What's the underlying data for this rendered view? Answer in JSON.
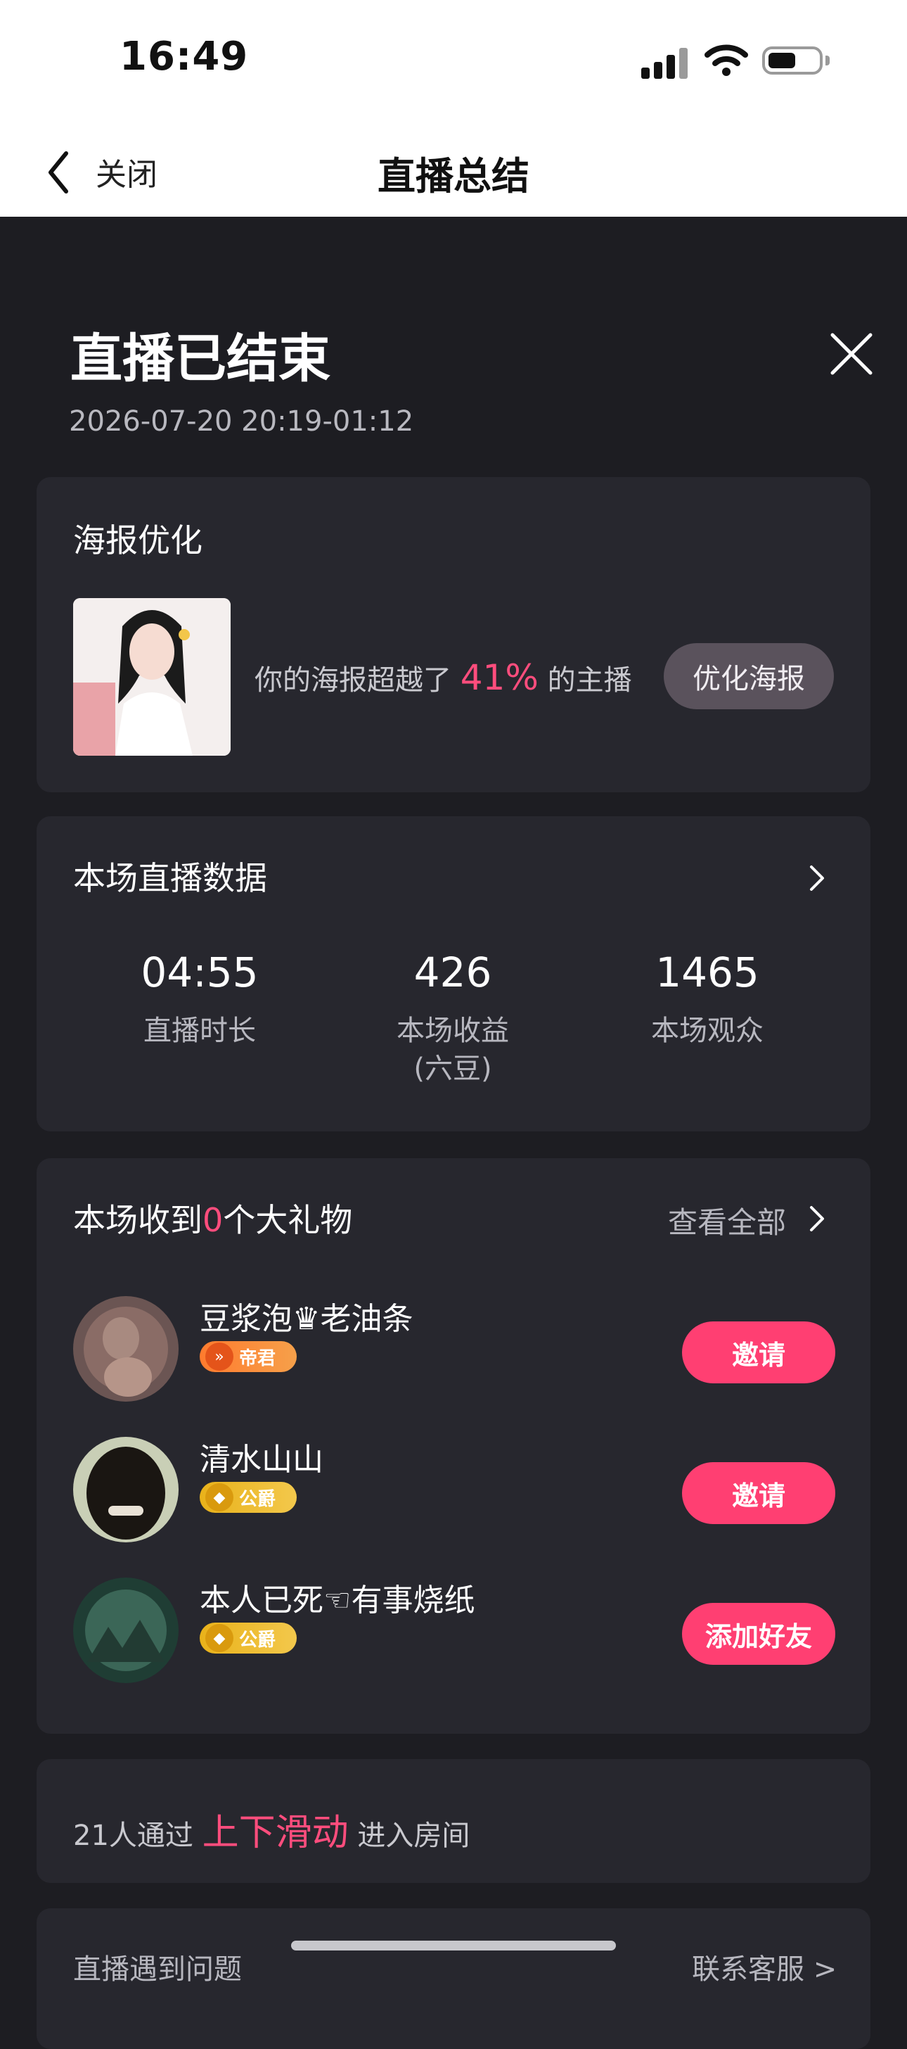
{
  "status_bar": {
    "time": "16:49"
  },
  "nav": {
    "back_label": "关闭",
    "title": "直播总结"
  },
  "header": {
    "title": "直播已结束",
    "time_range": "2026-07-20 20:19-01:12"
  },
  "poster": {
    "title": "海报优化",
    "text_before": "你的海报超越了",
    "percent": "41%",
    "text_after": "的主播",
    "button": "优化海报"
  },
  "stats": {
    "title": "本场直播数据",
    "items": [
      {
        "value": "04:55",
        "label": "直播时长"
      },
      {
        "value": "426",
        "label": "本场收益\n(六豆)"
      },
      {
        "value": "1465",
        "label": "本场观众"
      }
    ]
  },
  "gifts": {
    "prefix": "本场收到",
    "count": "0",
    "suffix": "个大礼物",
    "view_all": "查看全部",
    "users": [
      {
        "name": "豆浆泡♛老油条",
        "badge": "帝君",
        "action": "邀请"
      },
      {
        "name": "清水山山",
        "badge": "公爵",
        "action": "邀请"
      },
      {
        "name": "本人已死☜有事烧纸",
        "badge": "公爵",
        "action": "添加好友"
      }
    ]
  },
  "swipe": {
    "before": "21人通过",
    "highlight": "上下滑动",
    "after": "进入房间"
  },
  "help": {
    "question": "直播遇到问题",
    "contact": "联系客服 >"
  },
  "colors": {
    "accent": "#ff3f72",
    "background": "#1d1d22",
    "card": "#27272e"
  }
}
